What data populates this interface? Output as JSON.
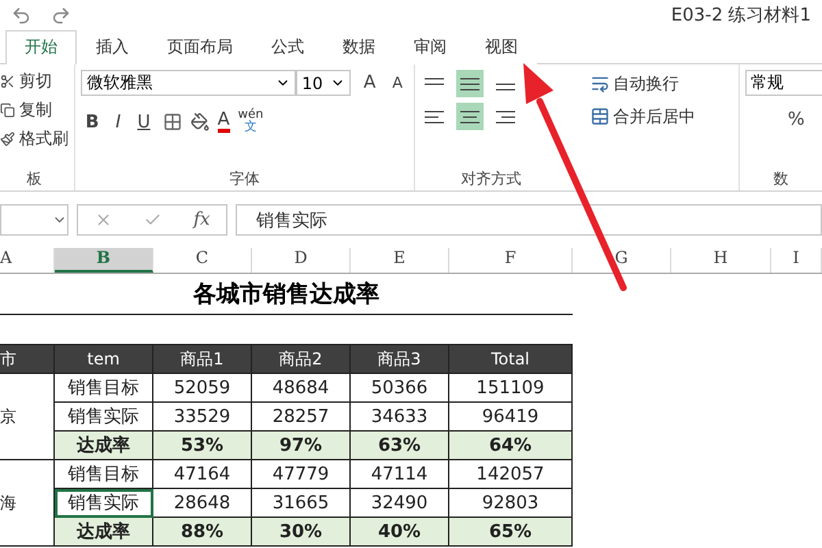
{
  "title_bar": {
    "title": "E03-2 练习材料1"
  },
  "ribbon_tabs": [
    {
      "label": "开始",
      "selected": true
    },
    {
      "label": "插入",
      "selected": false
    },
    {
      "label": "页面布局",
      "selected": false
    },
    {
      "label": "公式",
      "selected": false
    },
    {
      "label": "数据",
      "selected": false
    },
    {
      "label": "审阅",
      "selected": false
    },
    {
      "label": "视图",
      "selected": false
    }
  ],
  "clipboard": {
    "items": [
      "剪切",
      "复制",
      "格式刷"
    ],
    "group_label": "板"
  },
  "font": {
    "name": "微软雅黑",
    "size": "10",
    "grow": "A",
    "shrink": "A",
    "bold": "B",
    "italic": "I",
    "underline": "U",
    "font_color": "A",
    "phonetic": "wén",
    "phonetic_char": "文",
    "group_label": "字体"
  },
  "alignment": {
    "vertical": [
      {
        "kind": "top",
        "active": false
      },
      {
        "kind": "middle",
        "active": true
      },
      {
        "kind": "bottom",
        "active": false
      }
    ],
    "horizontal": [
      {
        "kind": "left",
        "active": false
      },
      {
        "kind": "center",
        "active": true
      },
      {
        "kind": "right",
        "active": false
      }
    ],
    "wrap": "自动换行",
    "merge": "合并后居中",
    "group_label": "对齐方式"
  },
  "number": {
    "format": "常规",
    "percent": "%",
    "group_label": "数"
  },
  "formula_bar": {
    "fx": "fx",
    "value": "销售实际"
  },
  "columns": [
    {
      "label": "A",
      "selected": false
    },
    {
      "label": "B",
      "selected": true
    },
    {
      "label": "C",
      "selected": false
    },
    {
      "label": "D",
      "selected": false
    },
    {
      "label": "E",
      "selected": false
    },
    {
      "label": "F",
      "selected": false
    },
    {
      "label": "G",
      "selected": false
    },
    {
      "label": "H",
      "selected": false
    },
    {
      "label": "I",
      "selected": false
    }
  ],
  "sheet_title": "各城市销售达成率",
  "table": {
    "header": [
      "市",
      "tem",
      "商品1",
      "商品2",
      "商品3",
      "Total"
    ],
    "groups": [
      {
        "city": "京",
        "rows": [
          {
            "kind": "plain",
            "selected": false,
            "cells": [
              "销售目标",
              "52059",
              "48684",
              "50366",
              "151109"
            ]
          },
          {
            "kind": "plain",
            "selected": false,
            "cells": [
              "销售实际",
              "33529",
              "28257",
              "34633",
              "96419"
            ]
          },
          {
            "kind": "rate",
            "selected": false,
            "cells": [
              "达成率",
              "53%",
              "97%",
              "63%",
              "64%"
            ]
          }
        ]
      },
      {
        "city": "海",
        "rows": [
          {
            "kind": "plain",
            "selected": false,
            "cells": [
              "销售目标",
              "47164",
              "47779",
              "47114",
              "142057"
            ]
          },
          {
            "kind": "plain",
            "selected": true,
            "cells": [
              "销售实际",
              "28648",
              "31665",
              "32490",
              "92803"
            ]
          },
          {
            "kind": "rate",
            "selected": false,
            "cells": [
              "达成率",
              "88%",
              "30%",
              "40%",
              "65%"
            ]
          }
        ]
      }
    ]
  }
}
